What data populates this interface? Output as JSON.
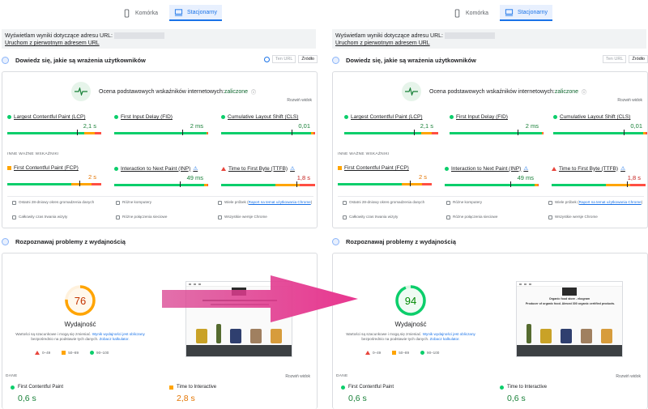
{
  "tabs": {
    "mobile": "Komórka",
    "desktop": "Stacjonarny"
  },
  "url_box": {
    "label": "Wyświetlam wyniki dotyczące adresu URL:",
    "link": "Uruchom z pierwotnym adresem URL"
  },
  "field_section": {
    "title": "Dowiedz się, jakie są wrażenia użytkowników",
    "toggle_url": "Ten URL",
    "toggle_origin": "Źródło"
  },
  "cwv": {
    "assessment": "Ocena podstawowych wskaźników internetowych:",
    "result": "zaliczone",
    "expand": "Rozwiń widok",
    "other_header": "INNE WAŻNE WSKAŹNIKI"
  },
  "metrics": {
    "lcp": {
      "name": "Largest Contentful Paint (LCP)",
      "value": "2,1 s"
    },
    "fid": {
      "name": "First Input Delay (FID)",
      "value": "2 ms"
    },
    "cls": {
      "name": "Cumulative Layout Shift (CLS)",
      "value": "0,01"
    },
    "fcp": {
      "name": "First Contentful Paint (FCP)",
      "value": "2 s"
    },
    "inp": {
      "name": "Interaction to Next Paint (INP)",
      "value": "49 ms"
    },
    "ttfb": {
      "name": "Time to First Byte (TTFB)",
      "value": "1,8 s"
    }
  },
  "footer": {
    "period": "Ostatni 28-dniowy okres gromadzenia danych",
    "devices": "Różne komputery",
    "samples_prefix": "Wiele próbek (",
    "samples_link": "Raport na temat użytkowania Chrome",
    "samples_suffix": ")",
    "duration": "Całkowity czas trwania wizyty",
    "network": "Różne połączenia sieciowe",
    "versions": "Wszystkie wersje Chrome"
  },
  "perf_section": {
    "title": "Rozpoznawaj problemy z wydajnością",
    "gauge_label": "Wydajność",
    "note_text": "Wartości są szacunkowe i mogą się zmieniać. ",
    "note_link": "Wynik wydajności jest obliczany",
    "note_tail": " bezpośrednio na podstawie tych danych. ",
    "note_link2": "Zobacz kalkulator.",
    "legend": {
      "fail": "0–49",
      "average": "50–89",
      "pass": "90–100"
    },
    "data_label": "DANE",
    "expand": "Rozwiń widok",
    "m1_name": "First Contentful Paint",
    "m2_name": "Time to Interactive"
  },
  "left": {
    "score": "76",
    "score_fraction": 0.76,
    "fcp": "0,6 s",
    "tti": "2,8 s"
  },
  "right": {
    "score": "94",
    "score_fraction": 0.94,
    "fcp": "0,6 s",
    "tti": "0,6 s"
  },
  "right_shot": {
    "headline": "Organic food store - ekogram",
    "subline": "Producer of organic food. Almost 300 organic certified products."
  },
  "colors": {
    "pass": "#0cce6b",
    "average": "#ffa400",
    "fail": "#ff4e42",
    "accent": "#1a73e8",
    "arrow": "#e8368f"
  }
}
